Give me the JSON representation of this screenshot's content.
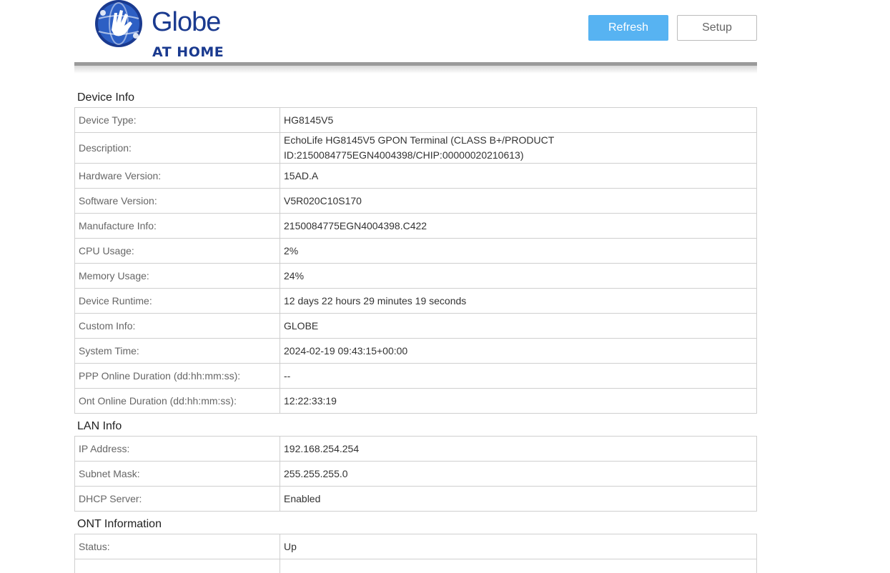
{
  "header": {
    "logo_word": "Globe",
    "logo_sub": "AT HOME",
    "refresh_label": "Refresh",
    "setup_label": "Setup"
  },
  "colors": {
    "brand_blue": "#1a3a8f",
    "refresh_button": "#57b3f2"
  },
  "device_info": {
    "title": "Device Info",
    "rows": [
      {
        "label": "Device Type:",
        "value": "HG8145V5"
      },
      {
        "label": "Description:",
        "value": "EchoLife HG8145V5 GPON Terminal (CLASS B+/PRODUCT ID:2150084775EGN4004398/CHIP:00000020210613)"
      },
      {
        "label": "Hardware Version:",
        "value": "15AD.A"
      },
      {
        "label": "Software Version:",
        "value": "V5R020C10S170"
      },
      {
        "label": "Manufacture Info:",
        "value": "2150084775EGN4004398.C422"
      },
      {
        "label": "CPU Usage:",
        "value": "2%"
      },
      {
        "label": "Memory Usage:",
        "value": "24%"
      },
      {
        "label": "Device Runtime:",
        "value": "12 days 22 hours 29 minutes 19 seconds"
      },
      {
        "label": "Custom Info:",
        "value": "GLOBE"
      },
      {
        "label": "System Time:",
        "value": "2024-02-19 09:43:15+00:00"
      },
      {
        "label": "PPP Online Duration (dd:hh:mm:ss):",
        "value": "--"
      },
      {
        "label": "Ont Online Duration (dd:hh:mm:ss):",
        "value": "12:22:33:19"
      }
    ]
  },
  "lan_info": {
    "title": "LAN Info",
    "rows": [
      {
        "label": "IP Address:",
        "value": "192.168.254.254"
      },
      {
        "label": "Subnet Mask:",
        "value": "255.255.255.0"
      },
      {
        "label": "DHCP Server:",
        "value": "Enabled"
      }
    ]
  },
  "ont_info": {
    "title": "ONT Information",
    "rows": [
      {
        "label": "Status:",
        "value": "Up"
      },
      {
        "label": "",
        "value": ""
      }
    ]
  }
}
